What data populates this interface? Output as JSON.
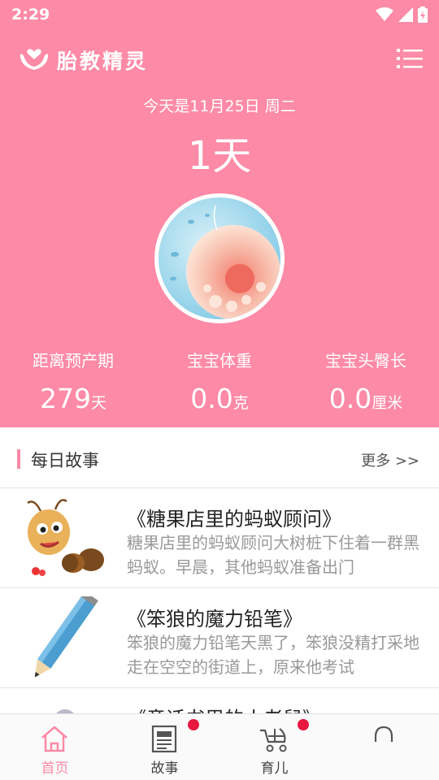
{
  "status_bar": {
    "time": "2:29",
    "icons": [
      "wifi-icon",
      "signal-icon",
      "battery-icon"
    ]
  },
  "app_bar": {
    "title": "胎教精灵",
    "logo_icon": "hands-heart-logo",
    "menu_icon": "list-menu-icon"
  },
  "summary": {
    "date_text": "今天是11月25日 周二",
    "day_count": "1天",
    "stats": [
      {
        "label": "距离预产期",
        "value": "279",
        "unit": "天"
      },
      {
        "label": "宝宝体重",
        "value": "0.0",
        "unit": "克"
      },
      {
        "label": "宝宝头臀长",
        "value": "0.0",
        "unit": "厘米"
      }
    ]
  },
  "daily_story": {
    "section_title": "每日故事",
    "more_label": "更多 >>",
    "items": [
      {
        "title": "《糖果店里的蚂蚁顾问》",
        "desc": "糖果店里的蚂蚁顾问大树桩下住着一群黑蚂蚁。早晨，其他蚂蚁准备出门",
        "thumb_icon": "ant-illustration"
      },
      {
        "title": "《笨狼的魔力铅笔》",
        "desc": "笨狼的魔力铅笔天黑了，笨狼没精打采地走在空空的街道上，原来他考试",
        "thumb_icon": "pencil-illustration"
      },
      {
        "title": "《童话书里的小老鼠》",
        "desc": "",
        "thumb_icon": "mouse-illustration"
      }
    ]
  },
  "tab_bar": {
    "tabs": [
      {
        "label": "首页",
        "icon": "home-icon",
        "active": true,
        "badge": false
      },
      {
        "label": "故事",
        "icon": "newspaper-icon",
        "active": false,
        "badge": true
      },
      {
        "label": "育儿",
        "icon": "stroller-icon",
        "active": false,
        "badge": true
      },
      {
        "label": "",
        "icon": "headset-icon",
        "active": false,
        "badge": false
      }
    ]
  },
  "colors": {
    "accent": "#fd8aa6",
    "badge": "#e8173f",
    "muted_text": "#999999"
  }
}
